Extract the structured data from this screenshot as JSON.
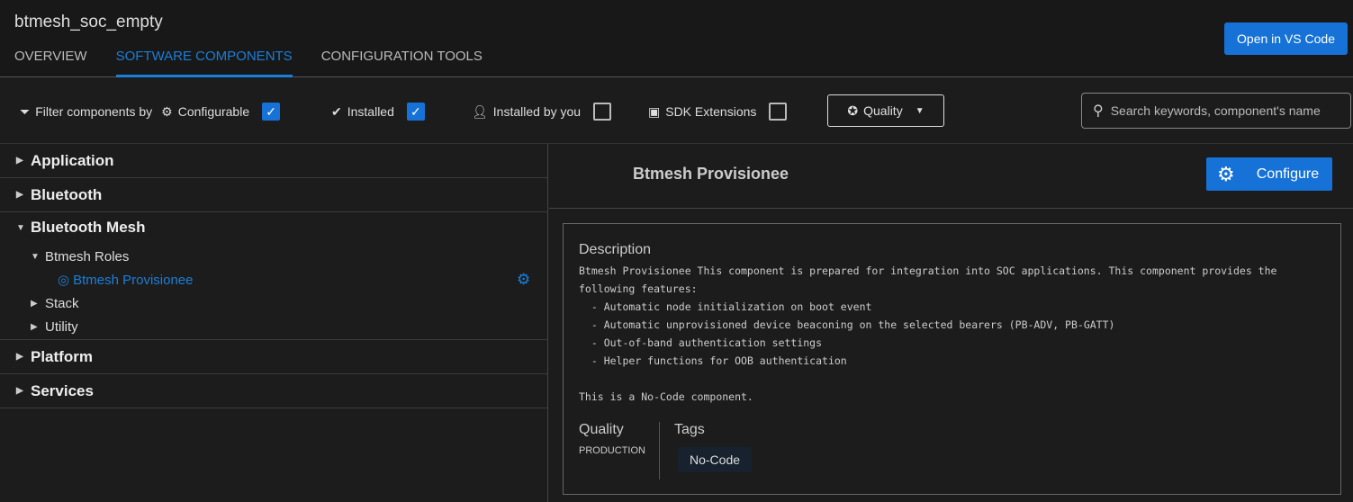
{
  "header": {
    "title": "btmesh_soc_empty",
    "tabs": [
      {
        "label": "OVERVIEW"
      },
      {
        "label": "SOFTWARE COMPONENTS",
        "active": true
      },
      {
        "label": "CONFIGURATION TOOLS"
      }
    ],
    "open_vscode": "Open in VS Code"
  },
  "filters": {
    "label": "Filter components by",
    "configurable": {
      "label": "Configurable",
      "checked": true
    },
    "installed": {
      "label": "Installed",
      "checked": true
    },
    "installed_by_you": {
      "label": "Installed by you",
      "checked": false
    },
    "sdk_extensions": {
      "label": "SDK Extensions",
      "checked": false
    },
    "quality": "Quality",
    "search_placeholder": "Search keywords, component's name"
  },
  "tree": {
    "application": "Application",
    "bluetooth": "Bluetooth",
    "bluetooth_mesh": "Bluetooth Mesh",
    "btmesh_roles": "Btmesh Roles",
    "btmesh_provisionee": "Btmesh Provisionee",
    "stack": "Stack",
    "utility": "Utility",
    "platform": "Platform",
    "services": "Services"
  },
  "detail": {
    "title": "Btmesh Provisionee",
    "configure": "Configure",
    "description_label": "Description",
    "description": "Btmesh Provisionee This component is prepared for integration into SOC applications. This component provides the\nfollowing features:\n  - Automatic node initialization on boot event\n  - Automatic unprovisioned device beaconing on the selected bearers (PB-ADV, PB-GATT)\n  - Out-of-band authentication settings\n  - Helper functions for OOB authentication\n\nThis is a No-Code component.",
    "quality_label": "Quality",
    "quality_value": "PRODUCTION",
    "tags_label": "Tags",
    "tags": [
      "No-Code"
    ]
  },
  "colors": {
    "accent": "#1672d6",
    "background": "#1c1c1c"
  }
}
